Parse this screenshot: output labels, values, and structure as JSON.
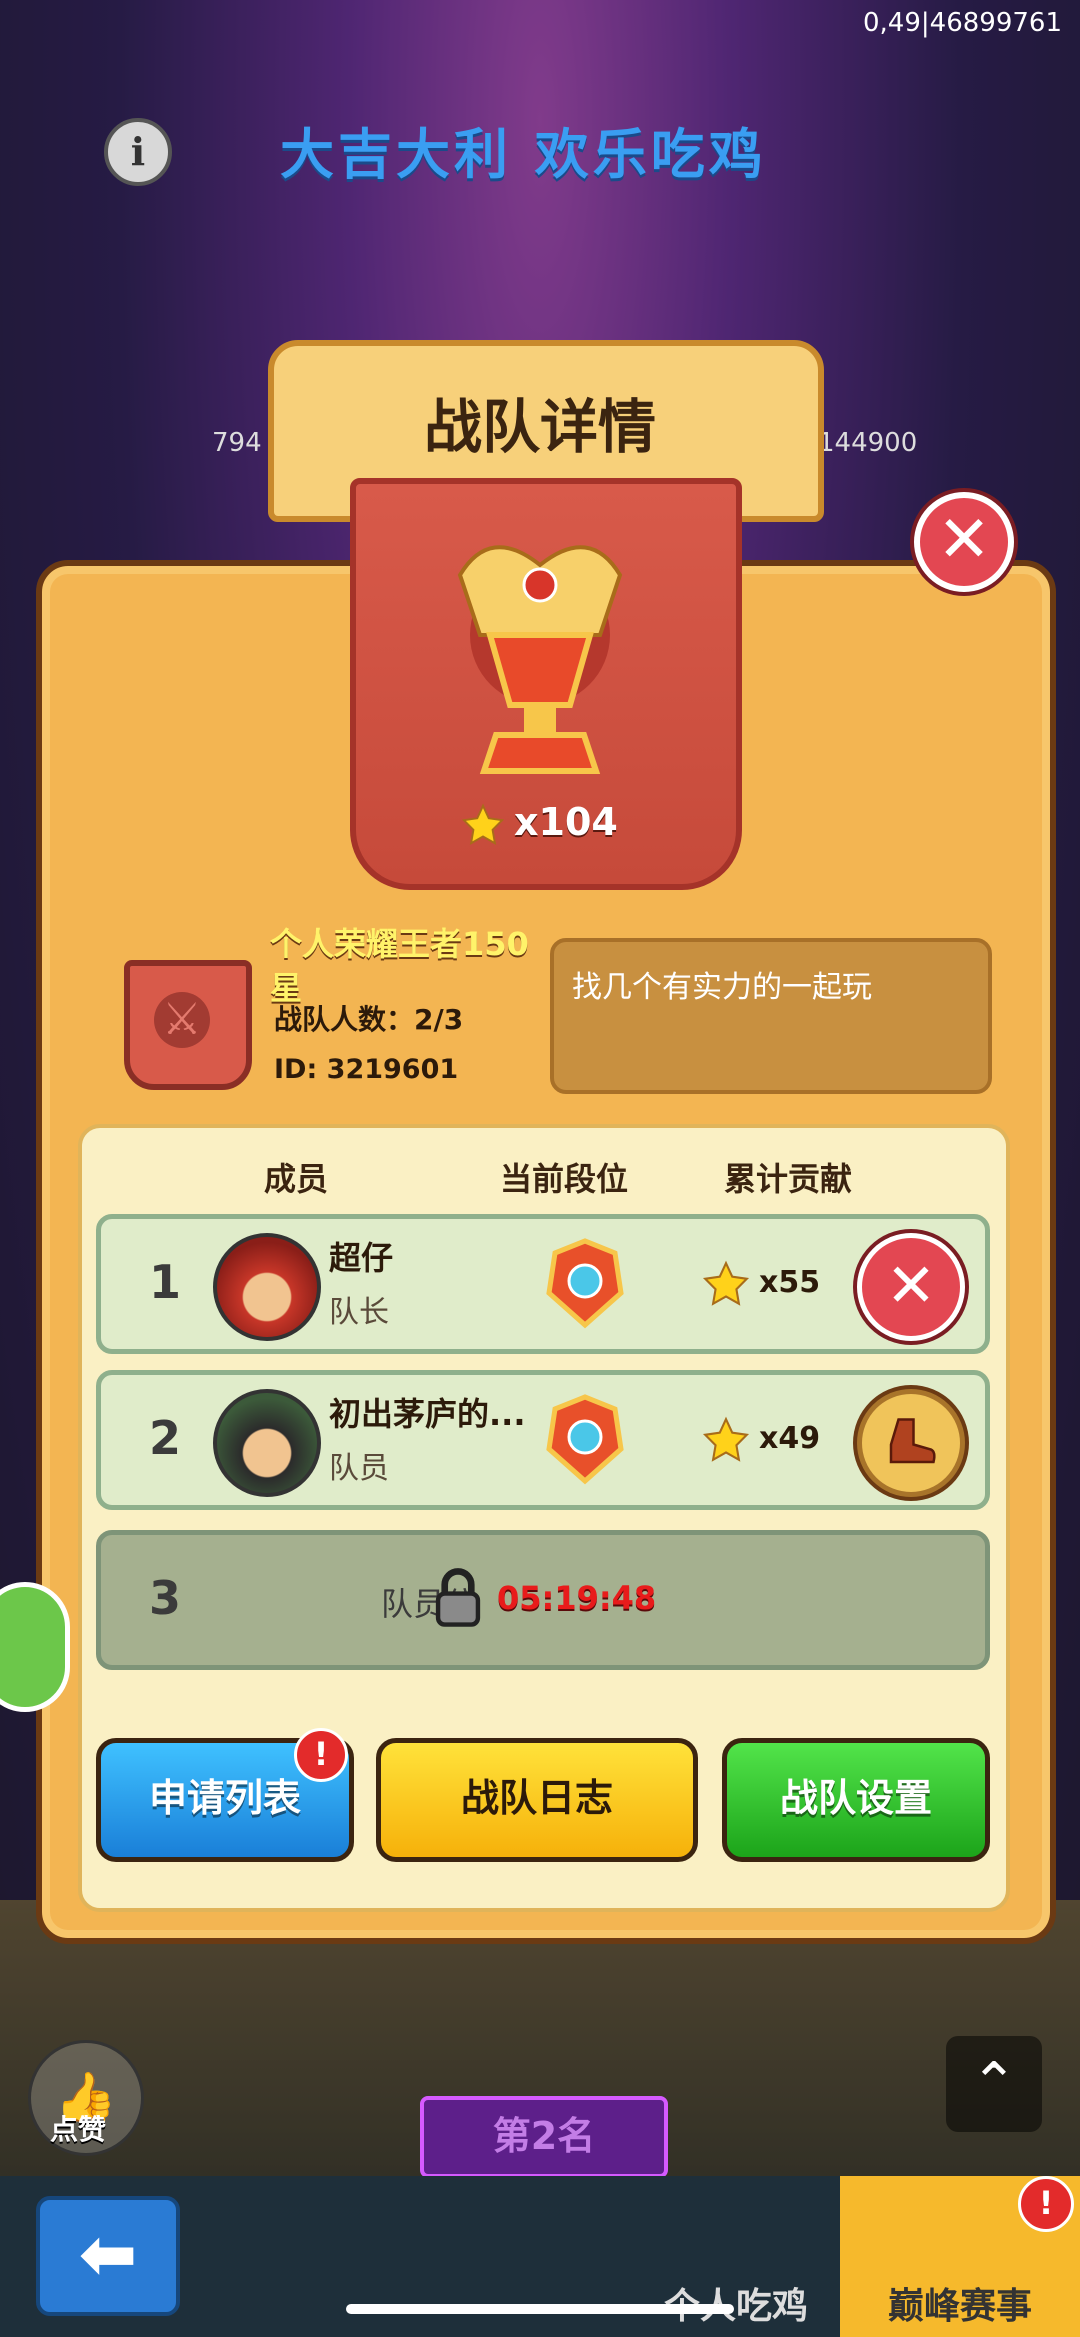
{
  "status": {
    "top_code": "0,49|46899761"
  },
  "background": {
    "event_title": "大吉大利 欢乐吃鸡",
    "left_number": "794",
    "right_number": "144900"
  },
  "panel": {
    "title": "战队详情",
    "star_count": "x104",
    "team_name": "个人荣耀王者150星",
    "member_count": "战队人数：2/3",
    "team_id": "ID: 3219601",
    "motto": "找几个有实力的一起玩"
  },
  "members": {
    "headers": {
      "member": "成员",
      "rank": "当前段位",
      "contribution": "累计贡献"
    },
    "rows": [
      {
        "index": "1",
        "name": "超仔",
        "role": "队长",
        "contribution": "x55",
        "action": "close-icon"
      },
      {
        "index": "2",
        "name": "初出茅庐的...",
        "role": "队员",
        "contribution": "x49",
        "action": "boot-icon"
      }
    ],
    "locked_slot": {
      "index": "3",
      "text": "队员位",
      "timer": "05:19:48"
    }
  },
  "buttons": {
    "apply_list": "申请列表",
    "apply_badge": "!",
    "team_log": "战队日志",
    "team_settings": "战队设置"
  },
  "footer": {
    "like_label": "点赞",
    "rank_pill": "第2名",
    "tab_solo": "个人吃鸡",
    "tab_peak": "巅峰赛事",
    "tab_badge": "!"
  },
  "colors": {
    "panel": "#f3b552",
    "banner": "#d85a4a",
    "timer": "#e81b1b"
  }
}
